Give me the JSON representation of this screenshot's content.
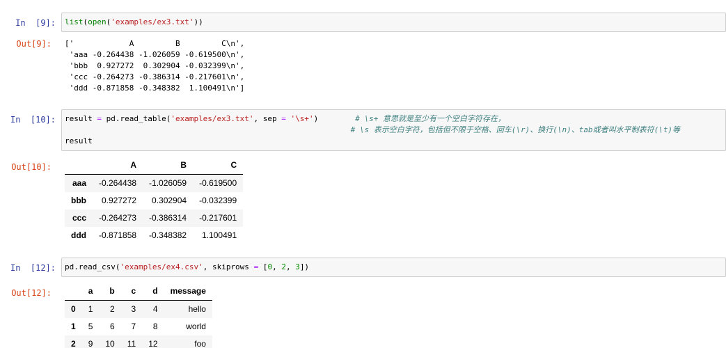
{
  "colors": {
    "in_prompt": "#303F9F",
    "out_prompt": "#D84315",
    "cell_background": "#F7F7F7",
    "cell_border": "#CFCFCF",
    "string_token": "#BA2121",
    "comment_token": "#408080",
    "operator_token": "#AA22FF",
    "builtin_token": "#008000",
    "number_token": "#008800",
    "table_stripe": "#F5F5F5"
  },
  "cells": [
    {
      "in_prompt": "In  [9]:",
      "out_prompt": "Out[9]:",
      "code_lines": [
        [
          {
            "t": "list",
            "c": "nb"
          },
          {
            "t": "(",
            "c": "p"
          },
          {
            "t": "open",
            "c": "nb"
          },
          {
            "t": "(",
            "c": "p"
          },
          {
            "t": "'examples/ex3.txt'",
            "c": "str"
          },
          {
            "t": "))",
            "c": "p"
          }
        ]
      ],
      "output_text": "['            A         B         C\\n',\n 'aaa -0.264438 -1.026059 -0.619500\\n',\n 'bbb  0.927272  0.302904 -0.032399\\n',\n 'ccc -0.264273 -0.386314 -0.217601\\n',\n 'ddd -0.871858 -0.348382  1.100491\\n']"
    },
    {
      "in_prompt": "In  [10]:",
      "out_prompt": "Out[10]:",
      "code_lines": [
        [
          {
            "t": "result ",
            "c": "p"
          },
          {
            "t": "=",
            "c": "op"
          },
          {
            "t": " pd.read_table(",
            "c": "p"
          },
          {
            "t": "'examples/ex3.txt'",
            "c": "str"
          },
          {
            "t": ", sep ",
            "c": "p"
          },
          {
            "t": "=",
            "c": "op"
          },
          {
            "t": " ",
            "c": "p"
          },
          {
            "t": "'\\s+'",
            "c": "str"
          },
          {
            "t": ")",
            "c": "p"
          },
          {
            "t": "        ",
            "c": "p"
          },
          {
            "t": "# \\s+ 意思就是至少有一个空白字符存在，",
            "c": "cmt"
          }
        ],
        [
          {
            "t": "                                                              ",
            "c": "p"
          },
          {
            "t": "# \\s 表示空白字符，包括但不限于空格、回车(\\r)、换行(\\n)、tab或者叫水平制表符(\\t)等",
            "c": "cmt"
          }
        ],
        [
          {
            "t": "result",
            "c": "p"
          }
        ]
      ],
      "table": {
        "columns": [
          "A",
          "B",
          "C"
        ],
        "index": [
          "aaa",
          "bbb",
          "ccc",
          "ddd"
        ],
        "rows": [
          [
            "-0.264438",
            "-1.026059",
            "-0.619500"
          ],
          [
            "0.927272",
            "0.302904",
            "-0.032399"
          ],
          [
            "-0.264273",
            "-0.386314",
            "-0.217601"
          ],
          [
            "-0.871858",
            "-0.348382",
            "1.100491"
          ]
        ]
      }
    },
    {
      "in_prompt": "In  [12]:",
      "out_prompt": "Out[12]:",
      "code_lines": [
        [
          {
            "t": "pd.read_csv(",
            "c": "p"
          },
          {
            "t": "'examples/ex4.csv'",
            "c": "str"
          },
          {
            "t": ", skiprows ",
            "c": "p"
          },
          {
            "t": "=",
            "c": "op"
          },
          {
            "t": " [",
            "c": "p"
          },
          {
            "t": "0",
            "c": "num"
          },
          {
            "t": ", ",
            "c": "p"
          },
          {
            "t": "2",
            "c": "num"
          },
          {
            "t": ", ",
            "c": "p"
          },
          {
            "t": "3",
            "c": "num"
          },
          {
            "t": "])",
            "c": "p"
          }
        ]
      ],
      "table": {
        "columns": [
          "a",
          "b",
          "c",
          "d",
          "message"
        ],
        "index": [
          "0",
          "1",
          "2"
        ],
        "rows": [
          [
            "1",
            "2",
            "3",
            "4",
            "hello"
          ],
          [
            "5",
            "6",
            "7",
            "8",
            "world"
          ],
          [
            "9",
            "10",
            "11",
            "12",
            "foo"
          ]
        ]
      }
    }
  ]
}
